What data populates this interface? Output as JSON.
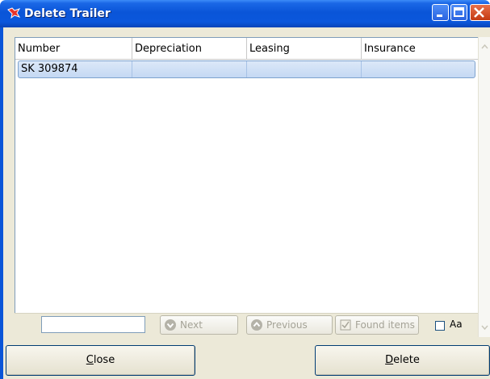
{
  "window": {
    "title": "Delete Trailer",
    "title_icon": "flag-icon",
    "accent": "#0a55d8"
  },
  "grid": {
    "columns": [
      "Number",
      "Depreciation",
      "Leasing",
      "Insurance"
    ],
    "rows": [
      {
        "number": "SK 309874",
        "depreciation": "",
        "leasing": "",
        "insurance": ""
      }
    ],
    "selected_row_color": "#c4d8f3"
  },
  "search": {
    "value": "",
    "next_label": "Next",
    "previous_label": "Previous",
    "found_items_label": "Found items",
    "case_label": "Aa",
    "case_checked": false
  },
  "actions": {
    "close_first": "C",
    "close_rest": "lose",
    "delete_first": "D",
    "delete_rest": "elete"
  }
}
